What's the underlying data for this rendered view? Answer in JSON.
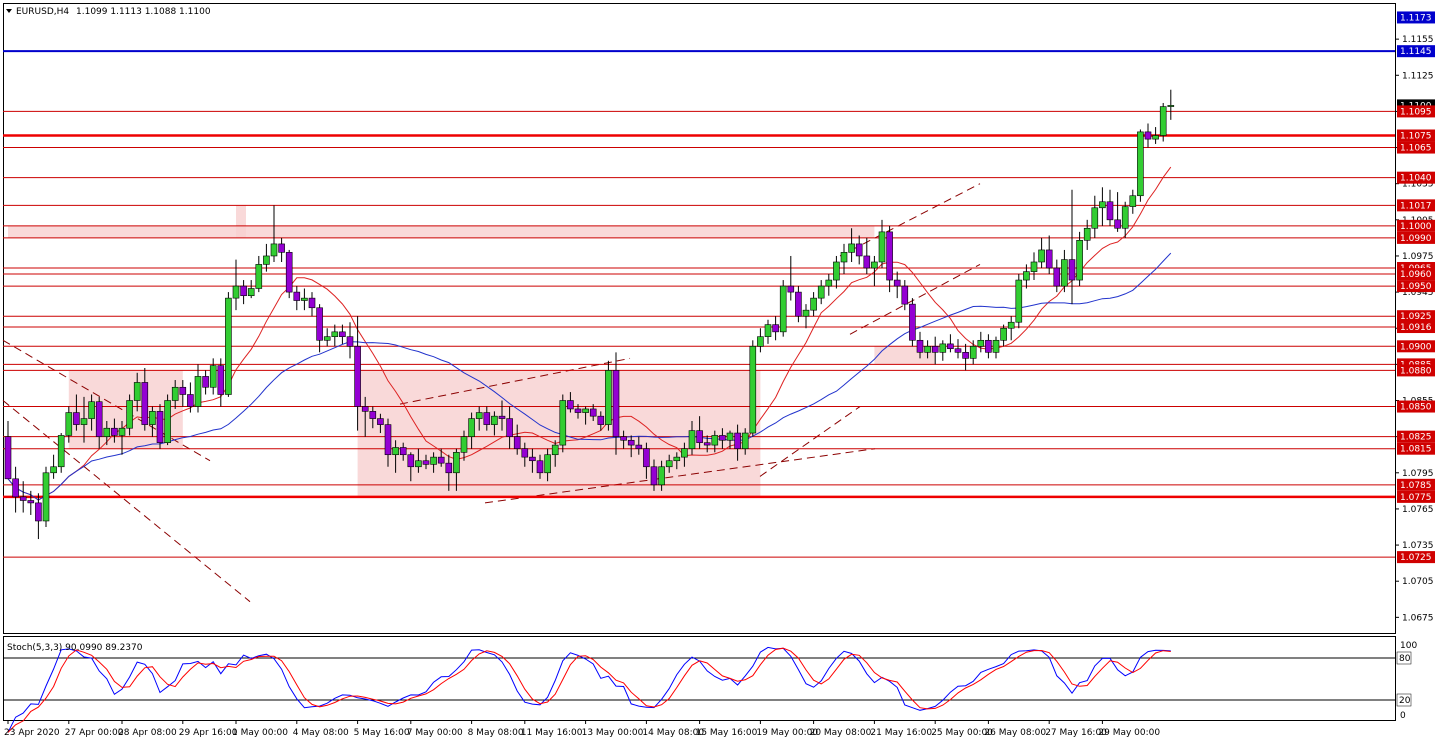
{
  "header": {
    "symbol": "EURUSD,H4",
    "ohlc": "1.1099 1.1113 1.1088 1.1100"
  },
  "indicator": {
    "label": "Stoch(5,3,3) 90.0990 89.2370",
    "levels": [
      "80",
      "20"
    ],
    "ticks": [
      "100",
      "0"
    ]
  },
  "price_ticks": [
    "1.1155",
    "1.1125",
    "1.1095",
    "1.1065",
    "1.1035",
    "1.1005",
    "1.0975",
    "1.0945",
    "1.0915",
    "1.0885",
    "1.0855",
    "1.0825",
    "1.0795",
    "1.0765",
    "1.0735",
    "1.0705",
    "1.0675"
  ],
  "time_ticks": [
    "23 Apr 2020",
    "27 Apr 00:00",
    "28 Apr 08:00",
    "29 Apr 16:00",
    "1 May 00:00",
    "4 May 08:00",
    "5 May 16:00",
    "7 May 00:00",
    "8 May 08:00",
    "11 May 16:00",
    "13 May 00:00",
    "14 May 08:00",
    "15 May 16:00",
    "19 May 00:00",
    "20 May 08:00",
    "21 May 16:00",
    "25 May 00:00",
    "26 May 08:00",
    "27 May 16:00",
    "29 May 00:00"
  ],
  "colors": {
    "bull": "#32cd32",
    "bear": "#9400d3",
    "level_line": "#cc0000",
    "strong_level": "#ee0000",
    "blue_level": "#0000cc",
    "zone": "#f8d0d0",
    "ma_fast": "#dd2222",
    "ma_slow": "#2233cc",
    "price_box": "#d00000",
    "current_box": "#000000"
  },
  "chart_data": {
    "type": "candlestick",
    "symbol": "EURUSD",
    "timeframe": "H4",
    "price_range": [
      1.0662,
      1.1185
    ],
    "levels": [
      {
        "price": 1.1173,
        "label": "1.1173",
        "style": "axis-box"
      },
      {
        "price": 1.1145,
        "label": "1.1145",
        "style": "blue"
      },
      {
        "price": 1.11,
        "label": "1.1100",
        "style": "current"
      },
      {
        "price": 1.1095,
        "label": "1.1095",
        "style": "thin"
      },
      {
        "price": 1.1075,
        "label": "1.1075",
        "style": "thick"
      },
      {
        "price": 1.1065,
        "label": "1.1065",
        "style": "thin"
      },
      {
        "price": 1.104,
        "label": "1.1040",
        "style": "thin"
      },
      {
        "price": 1.1017,
        "label": "1.1017",
        "style": "thin"
      },
      {
        "price": 1.1,
        "label": "1.1000",
        "style": "thin"
      },
      {
        "price": 1.099,
        "label": "1.0990",
        "style": "thin"
      },
      {
        "price": 1.0965,
        "label": "1.0965",
        "style": "thin"
      },
      {
        "price": 1.096,
        "label": "1.0960",
        "style": "thin"
      },
      {
        "price": 1.095,
        "label": "1.0950",
        "style": "thin"
      },
      {
        "price": 1.0925,
        "label": "1.0925",
        "style": "thin"
      },
      {
        "price": 1.0916,
        "label": "1.0916",
        "style": "thin"
      },
      {
        "price": 1.09,
        "label": "1.0900",
        "style": "thin"
      },
      {
        "price": 1.0885,
        "label": "1.0885",
        "style": "thin"
      },
      {
        "price": 1.088,
        "label": "1.0880",
        "style": "thin"
      },
      {
        "price": 1.085,
        "label": "1.0850",
        "style": "thin"
      },
      {
        "price": 1.0825,
        "label": "1.0825",
        "style": "thin"
      },
      {
        "price": 1.0815,
        "label": "1.0815",
        "style": "thin"
      },
      {
        "price": 1.0785,
        "label": "1.0785",
        "style": "thin"
      },
      {
        "price": 1.0775,
        "label": "1.0775",
        "style": "thick"
      },
      {
        "price": 1.0725,
        "label": "1.0725",
        "style": "thin"
      }
    ],
    "zones": [
      {
        "from": "27 Apr 00:00",
        "to": "29 Apr 16:00",
        "low": 1.0815,
        "high": 1.088
      },
      {
        "from": "5 May 16:00",
        "to": "19 May 00:00",
        "low": 1.0775,
        "high": 1.088
      },
      {
        "from": "1 May 00:00",
        "to": "1 May 00:00",
        "low": 1.099,
        "high": 1.1017
      },
      {
        "from": "23 Apr 2020",
        "to": "21 May 16:00",
        "low": 1.099,
        "high": 1.1
      },
      {
        "from": "21 May 16:00",
        "to": "25 May 00:00",
        "low": 1.0885,
        "high": 1.09
      }
    ],
    "candles": [
      [
        1.0825,
        1.0838,
        1.08,
        1.079
      ],
      [
        1.079,
        1.08,
        1.0762,
        1.0775
      ],
      [
        1.0775,
        1.0788,
        1.0762,
        1.0772
      ],
      [
        1.0772,
        1.078,
        1.076,
        1.077
      ],
      [
        1.077,
        1.0778,
        1.074,
        1.0755
      ],
      [
        1.0755,
        1.08,
        1.075,
        1.0795
      ],
      [
        1.0795,
        1.081,
        1.079,
        1.08
      ],
      [
        1.08,
        1.0828,
        1.0795,
        1.0826
      ],
      [
        1.0826,
        1.085,
        1.082,
        1.0845
      ],
      [
        1.0845,
        1.086,
        1.083,
        1.0835
      ],
      [
        1.0835,
        1.0858,
        1.082,
        1.084
      ],
      [
        1.084,
        1.086,
        1.083,
        1.0854
      ],
      [
        1.0854,
        1.0858,
        1.0815,
        1.0825
      ],
      [
        1.0825,
        1.0838,
        1.0818,
        1.0832
      ],
      [
        1.0832,
        1.084,
        1.082,
        1.0826
      ],
      [
        1.0826,
        1.0838,
        1.081,
        1.0832
      ],
      [
        1.0832,
        1.086,
        1.0826,
        1.0855
      ],
      [
        1.0855,
        1.0878,
        1.0846,
        1.087
      ],
      [
        1.087,
        1.0882,
        1.083,
        1.0835
      ],
      [
        1.0835,
        1.085,
        1.0825,
        1.0846
      ],
      [
        1.0846,
        1.0852,
        1.0815,
        1.082
      ],
      [
        1.082,
        1.086,
        1.0818,
        1.0855
      ],
      [
        1.0855,
        1.0872,
        1.0848,
        1.0866
      ],
      [
        1.0866,
        1.0872,
        1.085,
        1.086
      ],
      [
        1.086,
        1.087,
        1.0845,
        1.085
      ],
      [
        1.085,
        1.0885,
        1.0845,
        1.0875
      ],
      [
        1.0875,
        1.088,
        1.086,
        1.0866
      ],
      [
        1.0866,
        1.089,
        1.086,
        1.0884
      ],
      [
        1.0884,
        1.089,
        1.085,
        1.086
      ],
      [
        1.086,
        1.0945,
        1.0858,
        1.094
      ],
      [
        1.094,
        1.0972,
        1.093,
        1.095
      ],
      [
        1.095,
        1.0955,
        1.0935,
        1.0942
      ],
      [
        1.0942,
        1.0955,
        1.094,
        1.0948
      ],
      [
        1.0948,
        1.0975,
        1.0945,
        1.0968
      ],
      [
        1.0968,
        1.0985,
        1.0962,
        1.0975
      ],
      [
        1.0975,
        1.1017,
        1.097,
        1.0985
      ],
      [
        1.0985,
        1.099,
        1.097,
        1.0978
      ],
      [
        1.0978,
        1.098,
        1.094,
        1.0945
      ],
      [
        1.0945,
        1.095,
        1.093,
        1.0938
      ],
      [
        1.0938,
        1.0948,
        1.093,
        1.094
      ],
      [
        1.094,
        1.0945,
        1.0925,
        1.0932
      ],
      [
        1.0932,
        1.0935,
        1.0895,
        1.0905
      ],
      [
        1.0905,
        1.0915,
        1.09,
        1.0908
      ],
      [
        1.0908,
        1.0918,
        1.09,
        1.0912
      ],
      [
        1.0912,
        1.0918,
        1.0902,
        1.0908
      ],
      [
        1.0908,
        1.092,
        1.089,
        1.09
      ],
      [
        1.09,
        1.0925,
        1.083,
        1.085
      ],
      [
        1.085,
        1.0858,
        1.0825,
        1.0846
      ],
      [
        1.0846,
        1.085,
        1.0832,
        1.084
      ],
      [
        1.084,
        1.0844,
        1.0828,
        1.0835
      ],
      [
        1.0835,
        1.084,
        1.08,
        1.081
      ],
      [
        1.081,
        1.0822,
        1.0795,
        1.0816
      ],
      [
        1.0816,
        1.082,
        1.0805,
        1.081
      ],
      [
        1.081,
        1.0812,
        1.0788,
        1.08
      ],
      [
        1.08,
        1.0815,
        1.0795,
        1.0805
      ],
      [
        1.0805,
        1.081,
        1.0798,
        1.0802
      ],
      [
        1.0802,
        1.0812,
        1.0795,
        1.0808
      ],
      [
        1.0808,
        1.0815,
        1.08,
        1.0803
      ],
      [
        1.0803,
        1.081,
        1.078,
        1.0795
      ],
      [
        1.0795,
        1.0815,
        1.078,
        1.0812
      ],
      [
        1.0812,
        1.083,
        1.0805,
        1.0825
      ],
      [
        1.0825,
        1.0845,
        1.0815,
        1.084
      ],
      [
        1.084,
        1.085,
        1.083,
        1.0845
      ],
      [
        1.0845,
        1.085,
        1.083,
        1.0835
      ],
      [
        1.0835,
        1.0846,
        1.0826,
        1.0842
      ],
      [
        1.0842,
        1.0855,
        1.083,
        1.084
      ],
      [
        1.084,
        1.085,
        1.0815,
        1.0825
      ],
      [
        1.0825,
        1.0835,
        1.081,
        1.0815
      ],
      [
        1.0815,
        1.082,
        1.08,
        1.0808
      ],
      [
        1.0808,
        1.0815,
        1.0795,
        1.0805
      ],
      [
        1.0805,
        1.081,
        1.079,
        1.0795
      ],
      [
        1.0795,
        1.0815,
        1.0788,
        1.081
      ],
      [
        1.081,
        1.0822,
        1.08,
        1.0818
      ],
      [
        1.0818,
        1.086,
        1.0812,
        1.0855
      ],
      [
        1.0855,
        1.0862,
        1.0845,
        1.0848
      ],
      [
        1.0848,
        1.0852,
        1.084,
        1.0845
      ],
      [
        1.0845,
        1.085,
        1.0835,
        1.0848
      ],
      [
        1.0848,
        1.0852,
        1.0838,
        1.0842
      ],
      [
        1.0842,
        1.0846,
        1.083,
        1.0835
      ],
      [
        1.0835,
        1.0888,
        1.083,
        1.088
      ],
      [
        1.088,
        1.0895,
        1.081,
        1.0825
      ],
      [
        1.0825,
        1.083,
        1.0815,
        1.0822
      ],
      [
        1.0822,
        1.0826,
        1.0808,
        1.0818
      ],
      [
        1.0818,
        1.0825,
        1.081,
        1.0815
      ],
      [
        1.0815,
        1.082,
        1.079,
        1.08
      ],
      [
        1.08,
        1.0806,
        1.078,
        1.0785
      ],
      [
        1.0785,
        1.0805,
        1.078,
        1.08
      ],
      [
        1.08,
        1.081,
        1.0795,
        1.0805
      ],
      [
        1.0805,
        1.0812,
        1.0798,
        1.0808
      ],
      [
        1.0808,
        1.082,
        1.08,
        1.0815
      ],
      [
        1.0815,
        1.0838,
        1.081,
        1.083
      ],
      [
        1.083,
        1.0842,
        1.0815,
        1.082
      ],
      [
        1.082,
        1.0826,
        1.0812,
        1.0818
      ],
      [
        1.0818,
        1.083,
        1.0812,
        1.0826
      ],
      [
        1.0826,
        1.0832,
        1.0815,
        1.0822
      ],
      [
        1.0822,
        1.083,
        1.0815,
        1.0828
      ],
      [
        1.0828,
        1.0835,
        1.0805,
        1.0815
      ],
      [
        1.0815,
        1.0832,
        1.081,
        1.0828
      ],
      [
        1.0828,
        1.0905,
        1.0825,
        1.09
      ],
      [
        1.09,
        1.0915,
        1.0895,
        1.0908
      ],
      [
        1.0908,
        1.0922,
        1.0902,
        1.0918
      ],
      [
        1.0918,
        1.0925,
        1.0905,
        1.0912
      ],
      [
        1.0912,
        1.0955,
        1.0908,
        1.095
      ],
      [
        1.095,
        1.0975,
        1.0938,
        1.0945
      ],
      [
        1.0945,
        1.095,
        1.092,
        1.0925
      ],
      [
        1.0925,
        1.0935,
        1.0915,
        1.093
      ],
      [
        1.093,
        1.0945,
        1.0925,
        1.094
      ],
      [
        1.094,
        1.0955,
        1.0935,
        1.095
      ],
      [
        1.095,
        1.096,
        1.0942,
        1.0955
      ],
      [
        1.0955,
        1.0975,
        1.0948,
        1.097
      ],
      [
        1.097,
        1.0985,
        1.096,
        1.0978
      ],
      [
        1.0978,
        1.0998,
        1.097,
        1.0985
      ],
      [
        1.0985,
        1.0992,
        1.0968,
        1.0975
      ],
      [
        1.0975,
        1.099,
        1.096,
        1.0965
      ],
      [
        1.0965,
        1.0975,
        1.095,
        1.097
      ],
      [
        1.097,
        1.1005,
        1.0965,
        1.0995
      ],
      [
        1.0995,
        1.1,
        1.0945,
        1.0955
      ],
      [
        1.0955,
        1.0962,
        1.094,
        1.095
      ],
      [
        1.095,
        1.0955,
        1.093,
        1.0935
      ],
      [
        1.0935,
        1.094,
        1.09,
        1.0905
      ],
      [
        1.0905,
        1.0912,
        1.089,
        1.0895
      ],
      [
        1.0895,
        1.0905,
        1.089,
        1.09
      ],
      [
        1.09,
        1.0908,
        1.0885,
        1.0895
      ],
      [
        1.0895,
        1.0905,
        1.0888,
        1.0902
      ],
      [
        1.0902,
        1.091,
        1.0895,
        1.0898
      ],
      [
        1.0898,
        1.0906,
        1.089,
        1.0895
      ],
      [
        1.0895,
        1.0902,
        1.088,
        1.089
      ],
      [
        1.089,
        1.0905,
        1.0885,
        1.09
      ],
      [
        1.09,
        1.0912,
        1.0895,
        1.0905
      ],
      [
        1.0905,
        1.091,
        1.089,
        1.0895
      ],
      [
        1.0895,
        1.0908,
        1.089,
        1.0905
      ],
      [
        1.0905,
        1.0918,
        1.09,
        1.0915
      ],
      [
        1.0915,
        1.0925,
        1.0905,
        1.092
      ],
      [
        1.092,
        1.096,
        1.0915,
        1.0955
      ],
      [
        1.0955,
        1.0968,
        1.0948,
        1.0962
      ],
      [
        1.0962,
        1.0978,
        1.0955,
        1.097
      ],
      [
        1.097,
        1.099,
        1.0965,
        1.098
      ],
      [
        1.098,
        1.0992,
        1.096,
        1.0965
      ],
      [
        1.0965,
        1.0972,
        1.0945,
        1.095
      ],
      [
        1.095,
        1.098,
        1.0945,
        1.0972
      ],
      [
        1.0972,
        1.103,
        1.0935,
        1.0955
      ],
      [
        1.0955,
        1.0995,
        1.095,
        1.0988
      ],
      [
        1.0988,
        1.1005,
        1.098,
        1.0998
      ],
      [
        1.0998,
        1.1025,
        1.099,
        1.1015
      ],
      [
        1.1015,
        1.1032,
        1.1,
        1.102
      ],
      [
        1.102,
        1.103,
        1.1,
        1.1005
      ],
      [
        1.1005,
        1.1028,
        1.0995,
        1.0998
      ],
      [
        1.0998,
        1.102,
        1.099,
        1.1016
      ],
      [
        1.1016,
        1.103,
        1.101,
        1.1025
      ],
      [
        1.1025,
        1.108,
        1.102,
        1.1078
      ],
      [
        1.1078,
        1.1085,
        1.1065,
        1.1072
      ],
      [
        1.1072,
        1.1082,
        1.1068,
        1.1075
      ],
      [
        1.1075,
        1.1102,
        1.107,
        1.1099
      ],
      [
        1.1099,
        1.1113,
        1.1088,
        1.11
      ]
    ],
    "ma_fast_label": "",
    "ma_slow_label": "",
    "stochastic": {
      "name": "Stoch(5,3,3)",
      "k": 90.099,
      "d": 89.237,
      "levels": [
        80,
        20
      ],
      "range": [
        0,
        100
      ]
    }
  }
}
